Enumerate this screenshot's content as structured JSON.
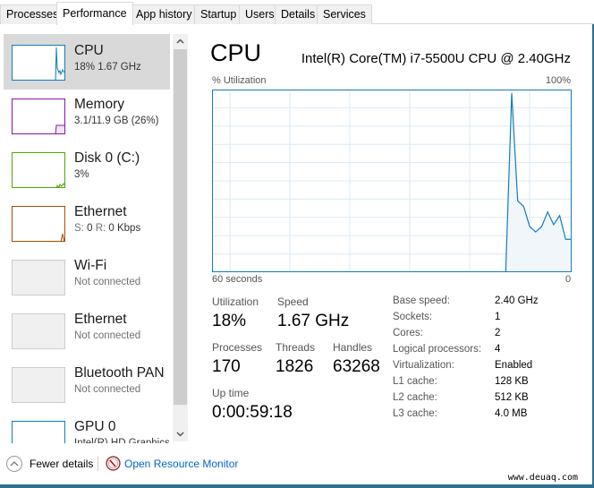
{
  "tabs": [
    {
      "label": "Processes",
      "active": false
    },
    {
      "label": "Performance",
      "active": true
    },
    {
      "label": "App history",
      "active": false
    },
    {
      "label": "Startup",
      "active": false
    },
    {
      "label": "Users",
      "active": false
    },
    {
      "label": "Details",
      "active": false
    },
    {
      "label": "Services",
      "active": false
    }
  ],
  "sidebar": {
    "items": [
      {
        "name": "CPU",
        "sub": "18% 1.67 GHz",
        "color": "#117dbb",
        "selected": true
      },
      {
        "name": "Memory",
        "sub": "3.1/11.9 GB (26%)",
        "color": "#8b12ae",
        "selected": false
      },
      {
        "name": "Disk 0 (C:)",
        "sub": "3%",
        "color": "#4da60c",
        "selected": false
      },
      {
        "name": "Ethernet",
        "sub_s_label": "S:",
        "sub_s_value": "0",
        "sub_r_label": "R:",
        "sub_r_value": "0 Kbps",
        "color": "#a74f01",
        "selected": false
      },
      {
        "name": "Wi-Fi",
        "sub": "Not connected",
        "selected": false
      },
      {
        "name": "Ethernet",
        "sub": "Not connected",
        "selected": false
      },
      {
        "name": "Bluetooth PAN",
        "sub": "Not connected",
        "selected": false
      },
      {
        "name": "GPU 0",
        "sub": "Intel(R) HD Graphics",
        "color": "#117dbb",
        "selected": false
      }
    ]
  },
  "scrollbar": {
    "up_icon": "chevron-up",
    "down_icon": "chevron-down"
  },
  "main": {
    "title": "CPU",
    "model": "Intel(R) Core(TM) i7-5500U CPU @ 2.40GHz",
    "graph_ylabel": "% Utilization",
    "graph_ymax_label": "100%",
    "graph_xleft_label": "60 seconds",
    "graph_xright_label": "0",
    "accent": "#117dbb",
    "stats": {
      "utilization_label": "Utilization",
      "utilization_value": "18%",
      "speed_label": "Speed",
      "speed_value": "1.67 GHz",
      "processes_label": "Processes",
      "processes_value": "170",
      "threads_label": "Threads",
      "threads_value": "1826",
      "handles_label": "Handles",
      "handles_value": "63268",
      "uptime_label": "Up time",
      "uptime_value": "0:00:59:18"
    },
    "specs": [
      {
        "label": "Base speed:",
        "value": "2.40 GHz"
      },
      {
        "label": "Sockets:",
        "value": "1"
      },
      {
        "label": "Cores:",
        "value": "2"
      },
      {
        "label": "Logical processors:",
        "value": "4"
      },
      {
        "label": "Virtualization:",
        "value": "Enabled"
      },
      {
        "label": "L1 cache:",
        "value": "128 KB"
      },
      {
        "label": "L2 cache:",
        "value": "512 KB"
      },
      {
        "label": "L3 cache:",
        "value": "4.0 MB"
      }
    ]
  },
  "chart_data": {
    "type": "area",
    "title": "% Utilization",
    "xlabel": "60 seconds",
    "x_range_seconds": [
      60,
      0
    ],
    "ylim": [
      0,
      100
    ],
    "grid": true,
    "series": [
      {
        "name": "CPU utilization",
        "color": "#117dbb",
        "x_seconds_ago": [
          11,
          10,
          9,
          8,
          7,
          6,
          5,
          4,
          3,
          2,
          1,
          0
        ],
        "values": [
          0,
          98,
          39,
          36,
          25,
          22,
          25,
          33,
          26,
          31,
          18,
          18
        ]
      }
    ]
  },
  "footer": {
    "fewer_details": "Fewer details",
    "open_resource_monitor": "Open Resource Monitor",
    "watermark": "www.deuaq.com"
  }
}
